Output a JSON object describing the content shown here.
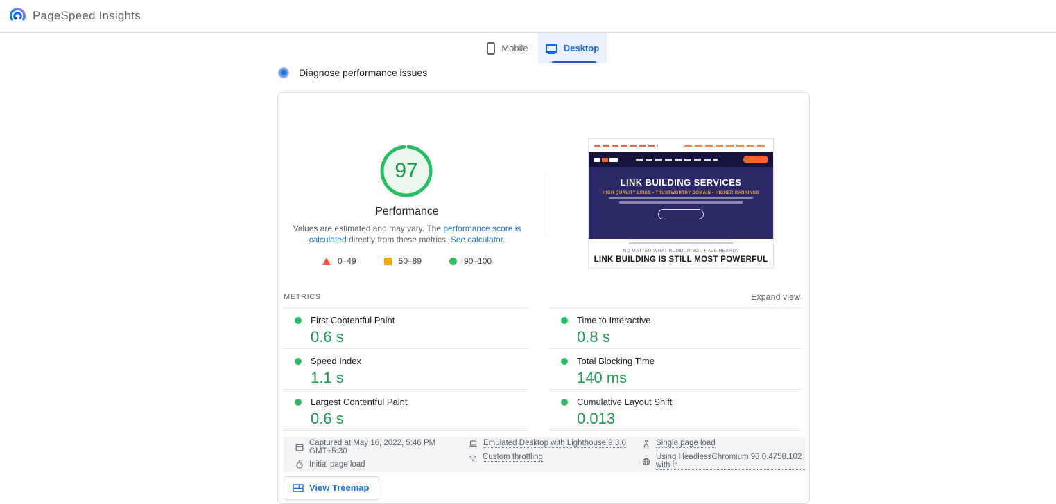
{
  "header": {
    "title": "PageSpeed Insights"
  },
  "tabs": {
    "mobile": {
      "label": "Mobile"
    },
    "desktop": {
      "label": "Desktop"
    }
  },
  "diagnose": {
    "label": "Diagnose performance issues"
  },
  "report": {
    "score": "97",
    "score_value": 97,
    "score_max": 100,
    "category": "Performance",
    "disclaimer_pre": "Values are estimated and may vary. The ",
    "disclaimer_link1": "performance score is calculated",
    "disclaimer_mid": " directly from these metrics. ",
    "disclaimer_link2": "See calculator.",
    "legend": [
      {
        "range": "0–49",
        "shape": "triangle",
        "color": "#ff4e42"
      },
      {
        "range": "50–89",
        "shape": "square",
        "color": "#ffa400"
      },
      {
        "range": "90–100",
        "shape": "circle",
        "color": "#28be64"
      }
    ],
    "metrics_title": "METRICS",
    "expand_view": "Expand view",
    "metrics": {
      "left": [
        {
          "label": "First Contentful Paint",
          "value": "0.6 s",
          "status": "pass"
        },
        {
          "label": "Speed Index",
          "value": "1.1 s",
          "status": "pass"
        },
        {
          "label": "Largest Contentful Paint",
          "value": "0.6 s",
          "status": "pass"
        }
      ],
      "right": [
        {
          "label": "Time to Interactive",
          "value": "0.8 s",
          "status": "pass"
        },
        {
          "label": "Total Blocking Time",
          "value": "140 ms",
          "status": "pass"
        },
        {
          "label": "Cumulative Layout Shift",
          "value": "0.013",
          "status": "pass"
        }
      ]
    },
    "capture": [
      {
        "icon": "calendar-icon",
        "text": "Captured at May 16, 2022, 5:46 PM GMT+5:30",
        "underlined": false
      },
      {
        "icon": "stopwatch-icon",
        "text": "Initial page load",
        "underlined": false
      },
      {
        "icon": "laptop-icon",
        "text": "Emulated Desktop with Lighthouse 9.3.0",
        "underlined": true
      },
      {
        "icon": "throttling-icon",
        "text": "Custom throttling",
        "underlined": true
      },
      {
        "icon": "fork-icon",
        "text": "Single page load",
        "underlined": true
      },
      {
        "icon": "globe-icon",
        "text": "Using HeadlessChromium 98.0.4758.102 with lr",
        "underlined": true
      }
    ],
    "treemap_label": "View Treemap"
  },
  "thumbnail": {
    "hero_title": "LINK BUILDING SERVICES",
    "hero_subtitle": "HIGH QUALITY LINKS • TRUSTWORTHY DOMAIN • HIGHER RANKINGS",
    "tagline_small": "NO MATTER WHAT RUMOUR YOU HAVE HEARD?",
    "tagline_big": "LINK BUILDING IS STILL MOST POWERFUL"
  },
  "colors": {
    "accent_blue": "#1a73e8",
    "tab_active": "#1967d2",
    "tab_active_bg": "#e8f0fe",
    "pass_green": "#28be64",
    "value_green": "#1d9b50",
    "fail_red": "#ff4e42",
    "average_orange": "#ffa400",
    "border_gray": "#dadce0",
    "text_gray": "#5f6368",
    "footer_bg": "#f1f3f4",
    "hero_navy": "#2b2968",
    "nav_navy": "#16143c",
    "brand_orange": "#f4642c"
  }
}
